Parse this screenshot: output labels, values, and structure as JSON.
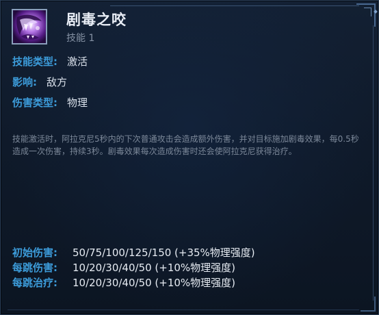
{
  "ability": {
    "name": "剧毒之咬",
    "slot": "技能 1",
    "icon": "spider-fang-icon"
  },
  "stats": [
    {
      "label": "技能类型:",
      "value": "激活"
    },
    {
      "label": "影响:",
      "value": "敌方"
    },
    {
      "label": "伤害类型:",
      "value": "物理"
    }
  ],
  "description": "技能激活时，阿拉克尼5秒内的下次普通攻击会造成额外伤害，并对目标施加剧毒效果，每0.5秒造成一次伤害，持续3秒。剧毒效果每次造成伤害时还会使阿拉克尼获得治疗。",
  "details": [
    {
      "label": "初始伤害:",
      "value": "50/75/100/125/150 (+35%物理强度)"
    },
    {
      "label": "每跳伤害:",
      "value": "10/20/30/40/50 (+10%物理强度)"
    },
    {
      "label": "每跳治疗:",
      "value": "10/20/30/40/50 (+10%物理强度)"
    }
  ],
  "colors": {
    "label_blue": "#3c9bd9",
    "value_white": "#d9e0ea",
    "description_gray": "#7c8899",
    "panel_bg": "#111c2c",
    "icon_purple": "#9b58cf"
  }
}
